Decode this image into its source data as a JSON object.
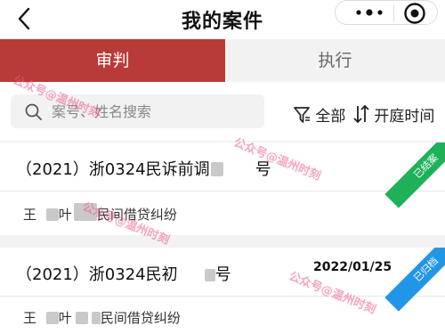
{
  "header": {
    "title": "我的案件"
  },
  "tabs": [
    {
      "label": "审判",
      "active": true
    },
    {
      "label": "执行",
      "active": false
    }
  ],
  "search": {
    "placeholder": "案号、姓名搜索"
  },
  "filter": {
    "label": "全部"
  },
  "sort": {
    "label": "开庭时间"
  },
  "watermark": "公众号@温州时刻",
  "cases": [
    {
      "case_prefix": "（2021）浙0324民诉前调",
      "case_suffix": "号",
      "date": "",
      "party": "王",
      "party_mid": "叶",
      "cause": "民间借贷纠纷",
      "status": "已结案"
    },
    {
      "case_prefix": "（2021）浙0324民初",
      "case_suffix": "号",
      "date": "2022/01/25",
      "party": "王",
      "party_mid": "叶",
      "cause": "民间借贷纠纷",
      "status": "已归档"
    }
  ],
  "colors": {
    "brand": "#b83b37",
    "closed": "#1fb15a",
    "archived": "#2196e8",
    "watermark": "#f15a8b"
  }
}
